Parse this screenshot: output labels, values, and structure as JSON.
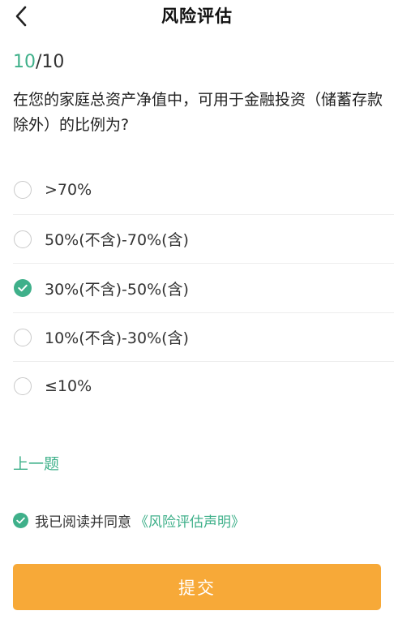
{
  "header": {
    "title": "风险评估",
    "back_icon": "chevron-left-icon"
  },
  "progress": {
    "current": "10",
    "separator": "/",
    "total": "10"
  },
  "question": {
    "text": "在您的家庭总资产净值中，可用于金融投资（储蓄存款除外）的比例为?"
  },
  "options": [
    {
      "label": ">70%",
      "checked": false
    },
    {
      "label": "50%(不含)-70%(含)",
      "checked": false
    },
    {
      "label": "30%(不含)-50%(含)",
      "checked": true
    },
    {
      "label": "10%(不含)-30%(含)",
      "checked": false
    },
    {
      "label": "≤10%",
      "checked": false
    }
  ],
  "prev_link": "上一题",
  "agreement": {
    "text": "我已阅读并同意",
    "link": "《风险评估声明》",
    "checked": true
  },
  "submit_label": "提交",
  "colors": {
    "accent_green": "#3fb08a",
    "submit_orange": "#f7a938",
    "text": "#222222"
  }
}
